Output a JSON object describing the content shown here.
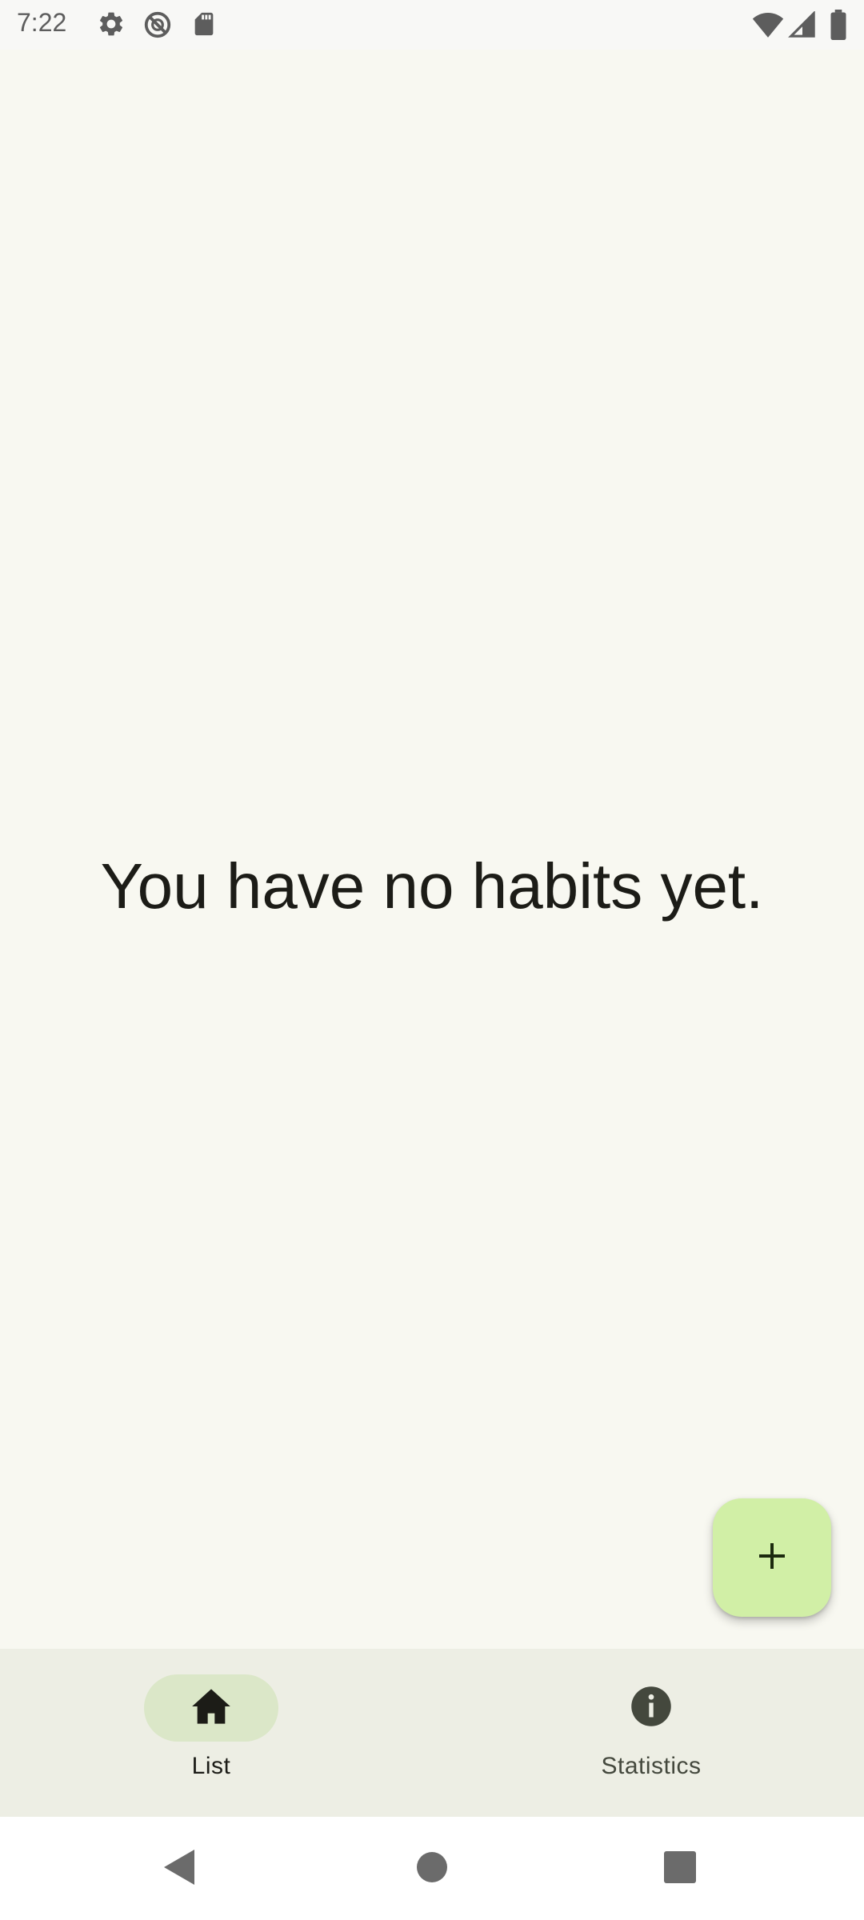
{
  "status_bar": {
    "time": "7:22",
    "icons_left": [
      "gear-icon",
      "do-not-disturb-icon",
      "sd-card-icon"
    ],
    "icons_right": [
      "wifi-icon",
      "cellular-signal-icon",
      "battery-icon"
    ]
  },
  "main": {
    "empty_message": "You have no habits yet."
  },
  "fab": {
    "icon": "plus-icon"
  },
  "bottom_nav": {
    "items": [
      {
        "label": "List",
        "icon": "home-icon",
        "active": true
      },
      {
        "label": "Statistics",
        "icon": "info-icon",
        "active": false
      }
    ]
  },
  "system_nav": {
    "buttons": [
      "back-icon",
      "home-circle-icon",
      "recents-icon"
    ]
  },
  "colors": {
    "background": "#f8f8f1",
    "fab": "#d1efa6",
    "nav_bar": "#edeee4",
    "active_pill": "#dbe7c8",
    "text": "#1c1c17"
  }
}
